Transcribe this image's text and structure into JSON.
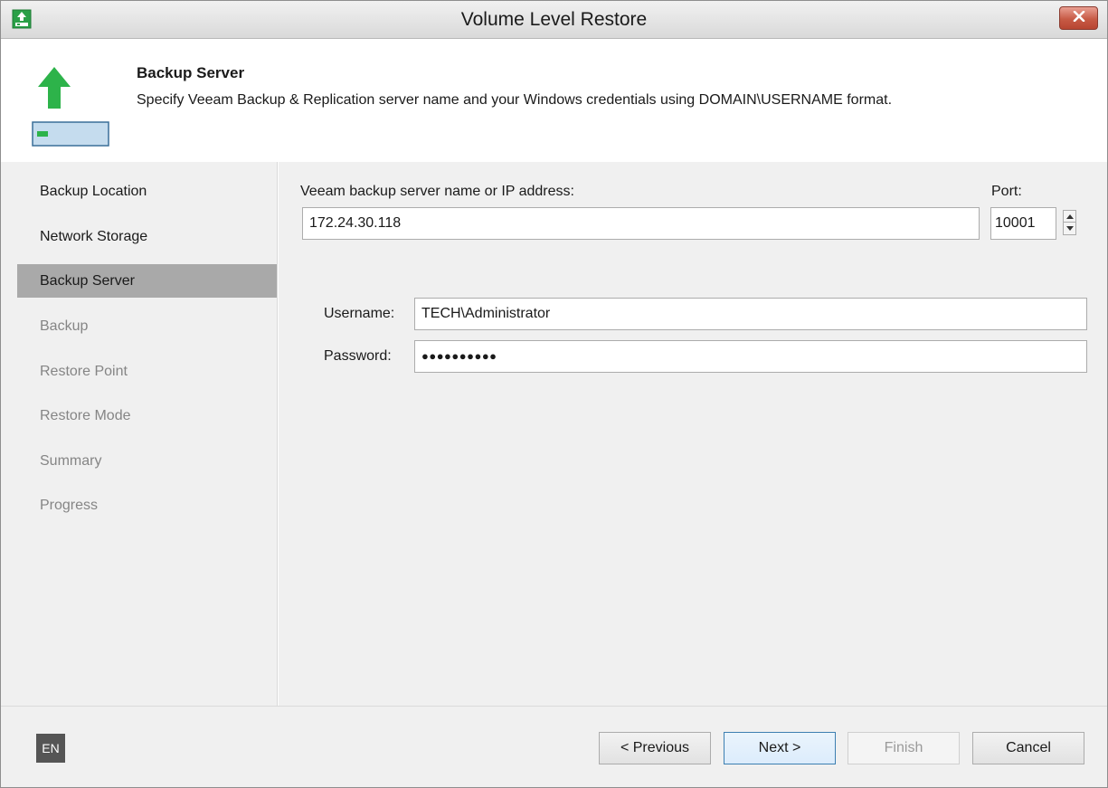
{
  "window": {
    "title": "Volume Level Restore",
    "close_icon": "close-icon",
    "app_icon": "volume-restore-icon"
  },
  "header": {
    "title": "Backup Server",
    "description": "Specify Veeam Backup & Replication server name and your Windows credentials using DOMAIN\\USERNAME format.",
    "icon": "upload-arrow-drive-icon"
  },
  "steps": [
    {
      "label": "Backup Location",
      "state": "completed"
    },
    {
      "label": "Network Storage",
      "state": "completed"
    },
    {
      "label": "Backup Server",
      "state": "active"
    },
    {
      "label": "Backup",
      "state": "disabled"
    },
    {
      "label": "Restore Point",
      "state": "disabled"
    },
    {
      "label": "Restore Mode",
      "state": "disabled"
    },
    {
      "label": "Summary",
      "state": "disabled"
    },
    {
      "label": "Progress",
      "state": "disabled"
    }
  ],
  "form": {
    "server_label": "Veeam backup server name or IP address:",
    "server_value": "172.24.30.118",
    "port_label": "Port:",
    "port_value": "10001",
    "username_label": "Username:",
    "username_value": "TECH\\Administrator",
    "password_label": "Password:",
    "password_value": "●●●●●●●●●●"
  },
  "footer": {
    "language": "EN",
    "previous_label": "< Previous",
    "next_label": "Next >",
    "finish_label": "Finish",
    "cancel_label": "Cancel"
  },
  "colors": {
    "accent_green": "#2db34a",
    "active_step_bg": "#a9a9a9",
    "panel_bg": "#f0f0f0",
    "default_button_border": "#3c7fb1"
  }
}
